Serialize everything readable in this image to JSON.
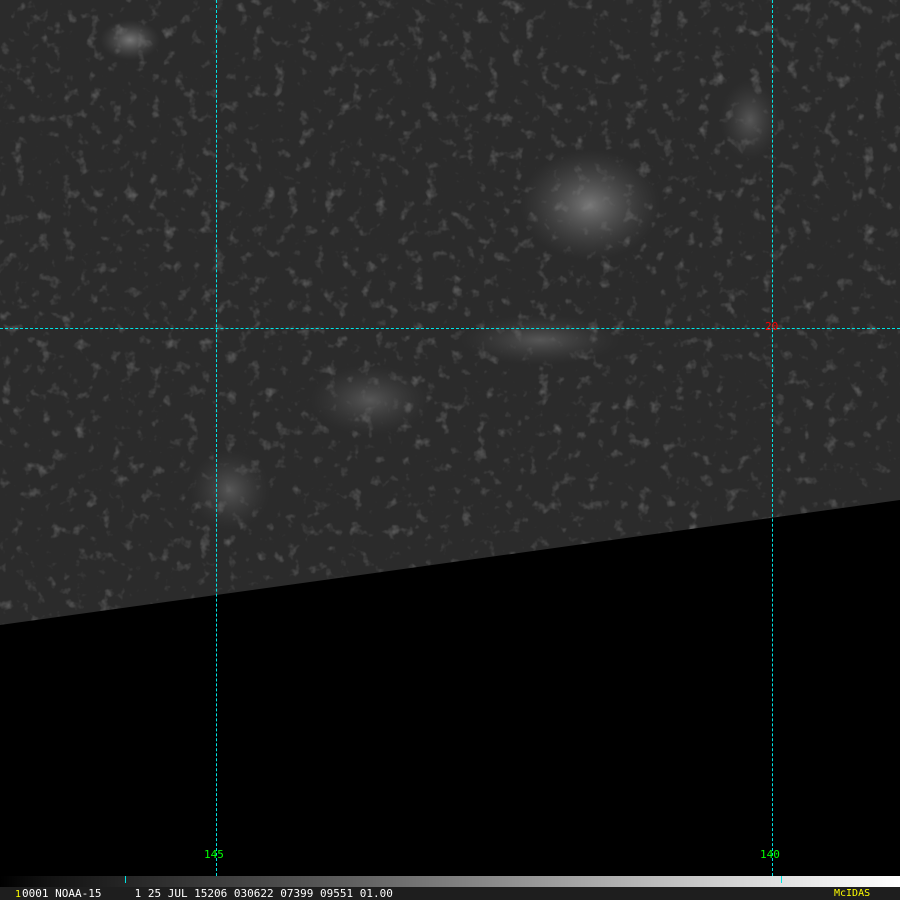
{
  "image": {
    "description_type": "satellite-imagery",
    "colors": {
      "grid": "#00e5e5",
      "lon_label": "#00ff00",
      "lat_label": "#ff0000",
      "logo": "#ffff00",
      "status_text": "#ffffff"
    }
  },
  "grid": {
    "longitude_labels": [
      "145",
      "140"
    ],
    "latitude_labels": [
      "20"
    ]
  },
  "status_bar": {
    "frame_number": "1",
    "info": "0001 NOAA-15     1 25 JUL 15206 030622 07399 09551 01.00",
    "logo": "McIDAS"
  }
}
